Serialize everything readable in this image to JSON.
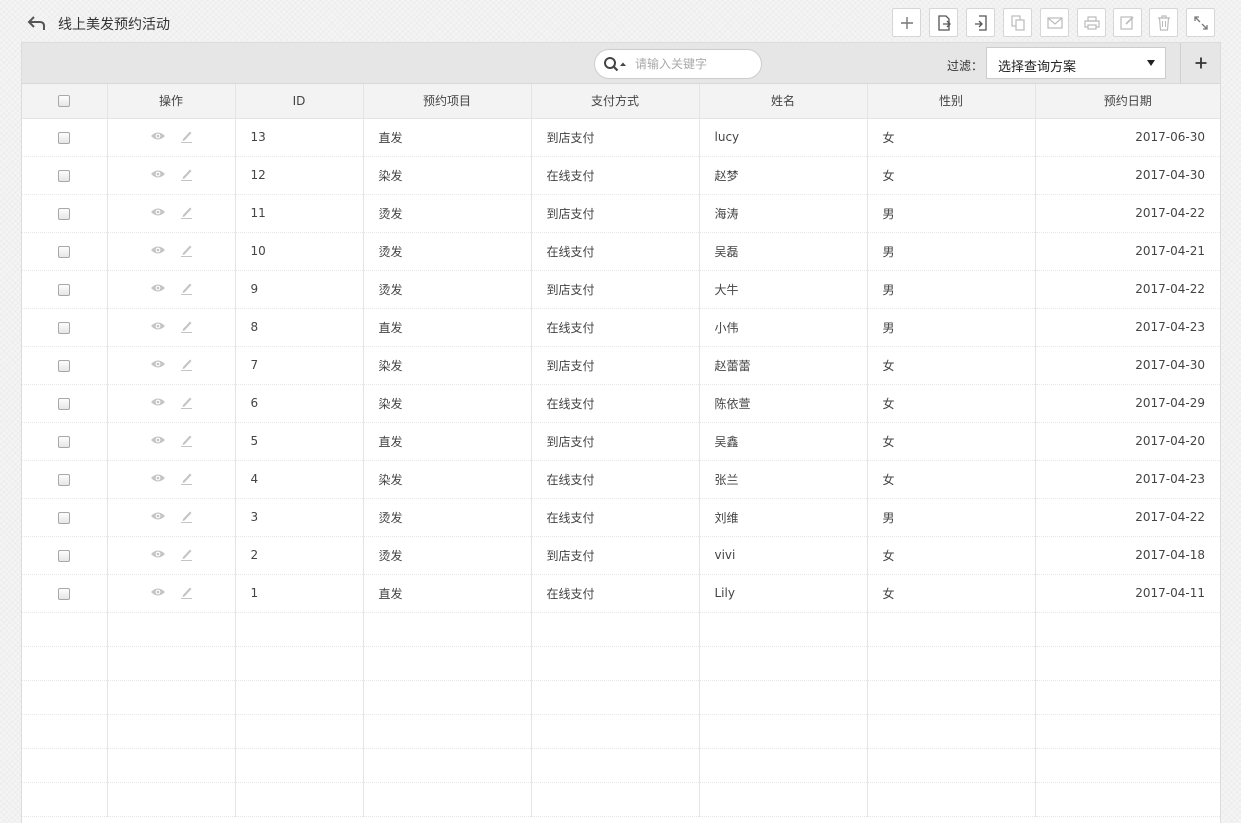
{
  "header": {
    "title": "线上美发预约活动",
    "toolbar": [
      {
        "name": "add-button",
        "icon": "plus-icon"
      },
      {
        "name": "export-button",
        "icon": "export-icon"
      },
      {
        "name": "import-button",
        "icon": "import-icon"
      },
      {
        "name": "copy-button",
        "icon": "copy-icon"
      },
      {
        "name": "email-button",
        "icon": "mail-icon"
      },
      {
        "name": "print-button",
        "icon": "printer-icon"
      },
      {
        "name": "batch-edit-button",
        "icon": "edit-icon"
      },
      {
        "name": "delete-button",
        "icon": "trash-icon"
      },
      {
        "name": "fullscreen-button",
        "icon": "expand-icon"
      }
    ]
  },
  "search": {
    "placeholder": "请输入关键字"
  },
  "filter": {
    "label": "过滤：",
    "selected": "选择查询方案"
  },
  "table": {
    "columns": [
      "操作",
      "ID",
      "预约项目",
      "支付方式",
      "姓名",
      "性别",
      "预约日期"
    ],
    "rows": [
      {
        "id": "13",
        "item": "直发",
        "payment": "到店支付",
        "name": "lucy",
        "gender": "女",
        "date": "2017-06-30"
      },
      {
        "id": "12",
        "item": "染发",
        "payment": "在线支付",
        "name": "赵梦",
        "gender": "女",
        "date": "2017-04-30"
      },
      {
        "id": "11",
        "item": "烫发",
        "payment": "到店支付",
        "name": "海涛",
        "gender": "男",
        "date": "2017-04-22"
      },
      {
        "id": "10",
        "item": "烫发",
        "payment": "在线支付",
        "name": "吴磊",
        "gender": "男",
        "date": "2017-04-21"
      },
      {
        "id": "9",
        "item": "烫发",
        "payment": "到店支付",
        "name": "大牛",
        "gender": "男",
        "date": "2017-04-22"
      },
      {
        "id": "8",
        "item": "直发",
        "payment": "在线支付",
        "name": "小伟",
        "gender": "男",
        "date": "2017-04-23"
      },
      {
        "id": "7",
        "item": "染发",
        "payment": "到店支付",
        "name": "赵蕾蕾",
        "gender": "女",
        "date": "2017-04-30"
      },
      {
        "id": "6",
        "item": "染发",
        "payment": "在线支付",
        "name": "陈依萱",
        "gender": "女",
        "date": "2017-04-29"
      },
      {
        "id": "5",
        "item": "直发",
        "payment": "到店支付",
        "name": "吴鑫",
        "gender": "女",
        "date": "2017-04-20"
      },
      {
        "id": "4",
        "item": "染发",
        "payment": "在线支付",
        "name": "张兰",
        "gender": "女",
        "date": "2017-04-23"
      },
      {
        "id": "3",
        "item": "烫发",
        "payment": "在线支付",
        "name": "刘维",
        "gender": "男",
        "date": "2017-04-22"
      },
      {
        "id": "2",
        "item": "烫发",
        "payment": "到店支付",
        "name": "vivi",
        "gender": "女",
        "date": "2017-04-18"
      },
      {
        "id": "1",
        "item": "直发",
        "payment": "在线支付",
        "name": "Lily",
        "gender": "女",
        "date": "2017-04-11"
      }
    ]
  }
}
